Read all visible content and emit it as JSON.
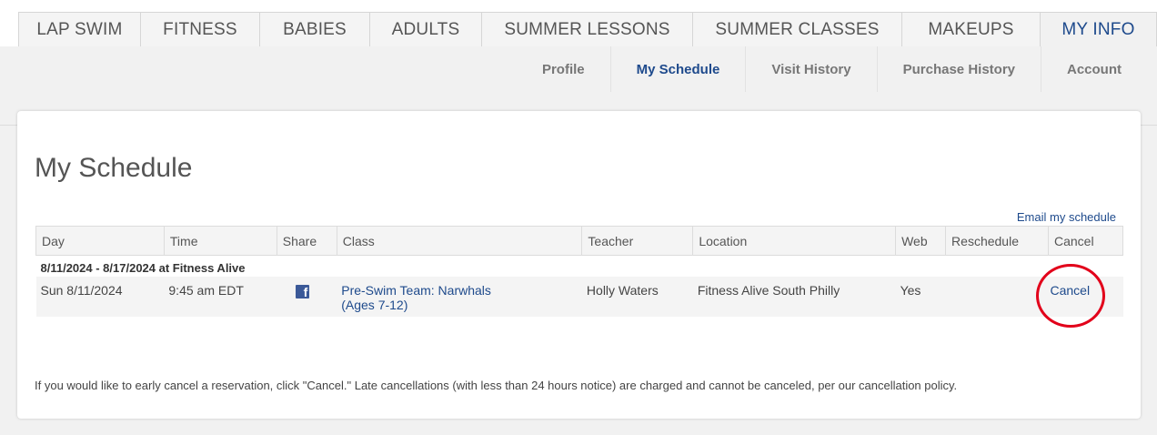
{
  "topnav": {
    "tabs": [
      {
        "label": "LAP SWIM",
        "active": false
      },
      {
        "label": "FITNESS",
        "active": false
      },
      {
        "label": "BABIES",
        "active": false
      },
      {
        "label": "ADULTS",
        "active": false
      },
      {
        "label": "SUMMER LESSONS",
        "active": false
      },
      {
        "label": "SUMMER CLASSES",
        "active": false
      },
      {
        "label": "MAKEUPS",
        "active": false
      },
      {
        "label": "MY INFO",
        "active": true
      }
    ]
  },
  "subnav": {
    "items": [
      {
        "label": "Profile",
        "active": false
      },
      {
        "label": "My Schedule",
        "active": true
      },
      {
        "label": "Visit History",
        "active": false
      },
      {
        "label": "Purchase History",
        "active": false
      },
      {
        "label": "Account",
        "active": false
      }
    ]
  },
  "main": {
    "title": "My Schedule",
    "email_link": "Email my schedule",
    "table": {
      "headers": [
        "Day",
        "Time",
        "Share",
        "Class",
        "Teacher",
        "Location",
        "Web",
        "Reschedule",
        "Cancel"
      ],
      "group_label": "8/11/2024 - 8/17/2024 at Fitness Alive",
      "rows": [
        {
          "day": "Sun 8/11/2024",
          "time": "9:45 am EDT",
          "share_icon": "facebook-icon",
          "class_line1": "Pre-Swim Team: Narwhals",
          "class_line2": "(Ages 7-12)",
          "teacher": "Holly Waters",
          "location": "Fitness Alive South Philly",
          "web": "Yes",
          "reschedule": "",
          "cancel": "Cancel"
        }
      ]
    },
    "policy_text": "If you would like to early cancel a reservation, click \"Cancel.\" Late cancellations (with less than 24 hours notice) are charged and cannot be canceled, per our cancellation policy."
  },
  "colors": {
    "accent": "#1e4a8c",
    "highlight_circle": "#e2001a",
    "facebook": "#3b5998"
  }
}
